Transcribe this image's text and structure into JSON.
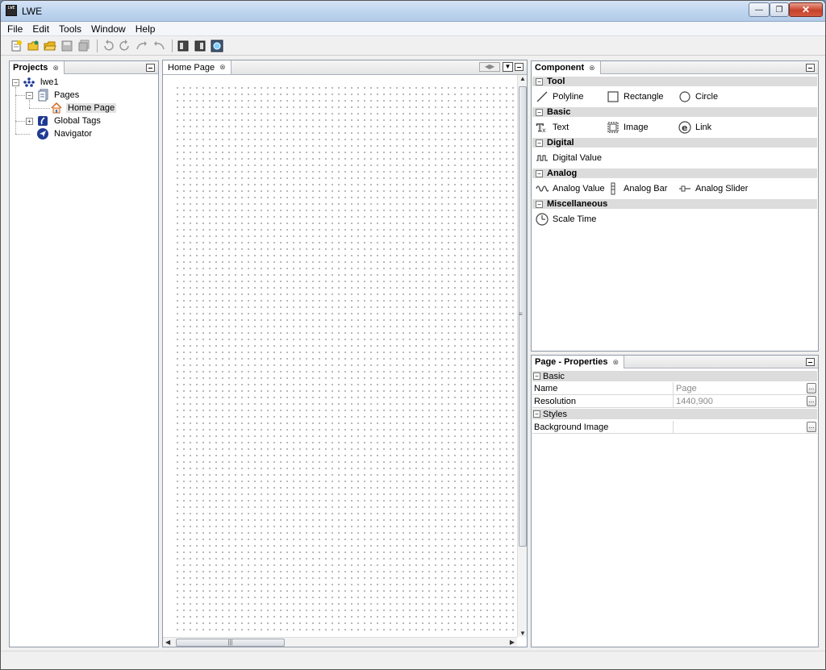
{
  "window": {
    "title": "LWE",
    "app_icon_text": "LWE"
  },
  "menu": [
    {
      "label": "File"
    },
    {
      "label": "Edit"
    },
    {
      "label": "Tools"
    },
    {
      "label": "Window"
    },
    {
      "label": "Help"
    }
  ],
  "toolbar": {
    "buttons": [
      "new-project-icon",
      "new-page-icon",
      "open-folder-icon",
      "save-icon",
      "save-all-icon",
      "undo-icon",
      "redo-icon",
      "redo-alt-icon",
      "undo-alt-icon",
      "panel-icon",
      "panel-alt-icon",
      "preview-icon"
    ]
  },
  "projects_panel": {
    "title": "Projects",
    "tree": {
      "root": "lwe1",
      "pages": "Pages",
      "home_page": "Home Page",
      "global_tags": "Global Tags",
      "navigator": "Navigator"
    }
  },
  "editor": {
    "tab_label": "Home Page"
  },
  "component_panel": {
    "title": "Component",
    "sections": {
      "tool": {
        "label": "Tool",
        "items": [
          "Polyline",
          "Rectangle",
          "Circle"
        ]
      },
      "basic": {
        "label": "Basic",
        "items": [
          "Text",
          "Image",
          "Link"
        ]
      },
      "digital": {
        "label": "Digital",
        "items": [
          "Digital Value"
        ]
      },
      "analog": {
        "label": "Analog",
        "items": [
          "Analog Value",
          "Analog Bar",
          "Analog Slider"
        ]
      },
      "misc": {
        "label": "Miscellaneous",
        "items": [
          "Scale Time"
        ]
      }
    }
  },
  "properties_panel": {
    "title": "Page - Properties",
    "basic_label": "Basic",
    "styles_label": "Styles",
    "rows": {
      "name": {
        "label": "Name",
        "value": "Page"
      },
      "resolution": {
        "label": "Resolution",
        "value": "1440,900"
      },
      "background_image": {
        "label": "Background Image",
        "value": ""
      }
    },
    "ellipsis": "..."
  },
  "colors": {
    "accent": "#1f3a93",
    "panel_border": "#8e9aa8",
    "section_bg": "#dcdcdc"
  }
}
